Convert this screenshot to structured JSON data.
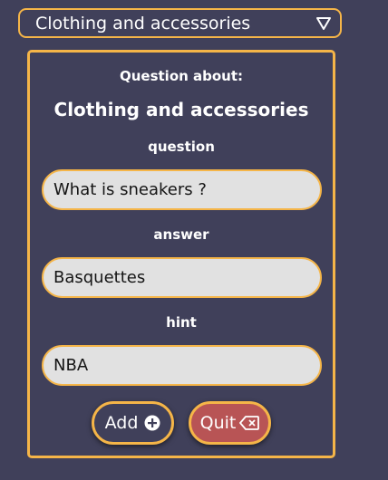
{
  "category_select": {
    "selected": "Clothing and accessories",
    "icon": "triangle-down-icon"
  },
  "form": {
    "heading": "Question about:",
    "category_title": "Clothing and accessories",
    "question": {
      "label": "question",
      "value": "What is sneakers ?"
    },
    "answer": {
      "label": "answer",
      "value": "Basquettes"
    },
    "hint": {
      "label": "hint",
      "value": "NBA"
    },
    "add_button": {
      "label": "Add",
      "icon": "plus-circle-icon"
    },
    "quit_button": {
      "label": "Quit",
      "icon": "backspace-x-icon"
    }
  },
  "colors": {
    "background": "#40405a",
    "accent": "#f5b548",
    "input_bg": "#e1e1e1",
    "quit_bg": "#b85455"
  }
}
